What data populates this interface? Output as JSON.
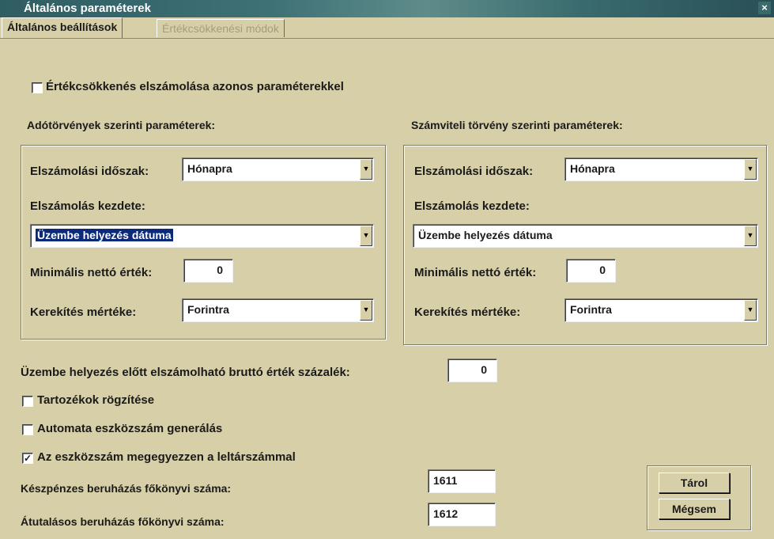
{
  "window": {
    "title": "Általános paraméterek",
    "close_glyph": "×"
  },
  "tabs": [
    {
      "label": "Általános beállítások",
      "active": true
    },
    {
      "label": "Értékcsökkenési módok",
      "active": false
    }
  ],
  "same_params_checkbox": {
    "label": "Értékcsökkenés elszámolása azonos paraméterekkel",
    "checked": false
  },
  "tax": {
    "heading": "Adótörvények szerinti paraméterek:",
    "period_label": "Elszámolási időszak:",
    "period_value": "Hónapra",
    "start_label": "Elszámolás kezdete:",
    "start_value": "Üzembe helyezés dátuma",
    "min_net_label": "Minimális nettó érték:",
    "min_net_value": "0",
    "rounding_label": "Kerekítés mértéke:",
    "rounding_value": "Forintra"
  },
  "accounting": {
    "heading": "Számviteli törvény szerinti paraméterek:",
    "period_label": "Elszámolási időszak:",
    "period_value": "Hónapra",
    "start_label": "Elszámolás kezdete:",
    "start_value": "Üzembe helyezés dátuma",
    "min_net_label": "Minimális nettó érték:",
    "min_net_value": "0",
    "rounding_label": "Kerekítés mértéke:",
    "rounding_value": "Forintra"
  },
  "gross_percent": {
    "label": "Üzembe helyezés előtt elszámolható bruttó érték százalék:",
    "value": "0"
  },
  "checkboxes": [
    {
      "label": "Tartozékok rögzítése",
      "checked": false
    },
    {
      "label": "Automata eszközszám generálás",
      "checked": false
    },
    {
      "label": "Az eszközszám megegyezzen a leltárszámmal",
      "checked": true,
      "mark": "✓"
    }
  ],
  "cash_ledger": {
    "label": "Készpénzes beruházás főkönyvi száma:",
    "value": "1611"
  },
  "transfer_ledger": {
    "label": "Átutalásos beruházás főkönyvi száma:",
    "value": "1612"
  },
  "buttons": {
    "store": "Tárol",
    "cancel": "Mégsem"
  },
  "dropdown_glyph": "▼"
}
